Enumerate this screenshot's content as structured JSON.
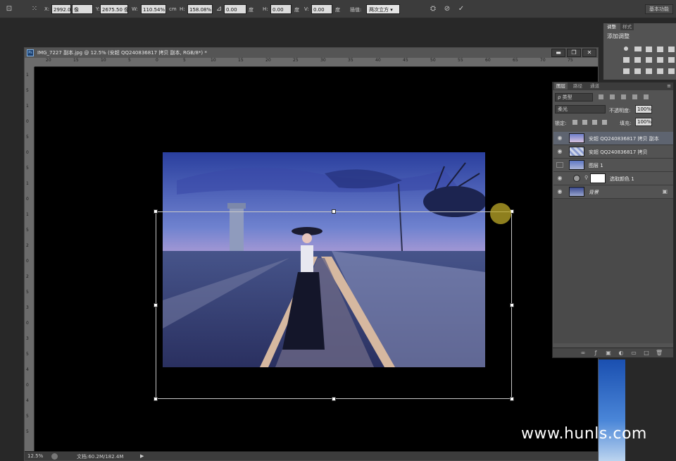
{
  "options_bar": {
    "x_label": "X:",
    "x_value": "2992.0",
    "x_unit": "像",
    "y_label": "Y:",
    "y_value": "2675.50 像",
    "w_label": "W:",
    "w_value": "110.54%",
    "link_unit": "cm",
    "h_label": "H:",
    "h_value": "158.08%",
    "angle_value": "0.00",
    "angle_unit": "度",
    "hskew_label": "H:",
    "hskew_value": "0.00",
    "hskew_unit": "度",
    "vskew_label": "V:",
    "vskew_value": "0.00",
    "vskew_unit": "度",
    "interp_label": "插值:",
    "interp_value": "两次立方",
    "workspace_label": "基本功能"
  },
  "document": {
    "title": "IMG_7227 副本.jpg @ 12.5% (安超 QQ240836817 拷贝 副本, RGB/8*) *",
    "ps_badge": "Ps",
    "minimize_glyph": "▬",
    "restore_glyph": "❐",
    "close_glyph": "✕",
    "ruler_top": [
      "20",
      "15",
      "10",
      "5",
      "0",
      "5",
      "10",
      "15",
      "20",
      "25",
      "30",
      "35",
      "40",
      "45",
      "50",
      "55",
      "60",
      "65",
      "70",
      "75"
    ],
    "ruler_left": [
      "1",
      "5",
      "1",
      "0",
      "5",
      "0",
      "5",
      "1",
      "0",
      "1",
      "5",
      "2",
      "0",
      "2",
      "5",
      "3",
      "0",
      "3",
      "5",
      "4",
      "0",
      "4",
      "5",
      "5"
    ],
    "zoom": "12.5%",
    "doc_info": "文档:60.2M/182.4M"
  },
  "adjustments": {
    "tab_adjust": "调整",
    "tab_styles": "样式",
    "title": "添加调整"
  },
  "layers": {
    "tab_layers": "图层",
    "tab_paths": "路径",
    "tab_channels": "通道",
    "filter_kind": "ρ 类型",
    "blend_mode": "柔光",
    "opacity_label": "不透明度:",
    "opacity_value": "100%",
    "lock_label": "锁定:",
    "fill_label": "填充:",
    "fill_value": "100%",
    "items": [
      {
        "name": "安超 QQ240836817 拷贝 副本",
        "visible": true,
        "selected": true
      },
      {
        "name": "安超 QQ240836817 拷贝",
        "visible": true,
        "selected": false
      },
      {
        "name": "图层 1",
        "visible": false,
        "selected": false
      },
      {
        "name": "选取颜色 1",
        "visible": true,
        "selected": false
      },
      {
        "name": "背景",
        "visible": true,
        "selected": false
      }
    ]
  },
  "watermark": "www.hunls.com",
  "colors": {
    "accent_cursor": "#bea828",
    "selected_layer": "#5e6470"
  }
}
